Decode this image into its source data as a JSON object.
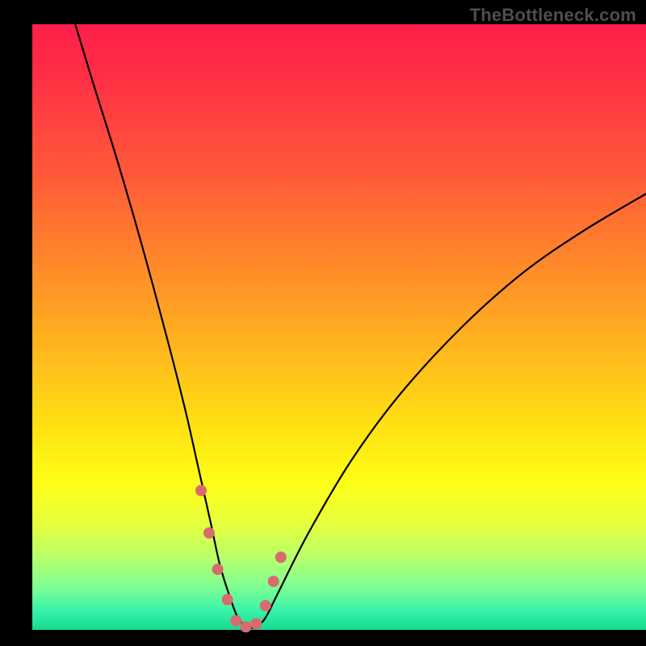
{
  "watermark": "TheBottleneck.com",
  "chart_data": {
    "type": "line",
    "title": "",
    "xlabel": "",
    "ylabel": "",
    "xlim": [
      0,
      100
    ],
    "ylim": [
      0,
      100
    ],
    "grid": false,
    "legend": false,
    "series": [
      {
        "name": "bottleneck-curve",
        "x": [
          7,
          10,
          14,
          18,
          22,
          25,
          27,
          29,
          30.5,
          32,
          33.5,
          35,
          36.5,
          38,
          40,
          45,
          52,
          60,
          70,
          80,
          90,
          100
        ],
        "values": [
          100,
          90,
          77,
          63,
          48,
          36,
          27,
          18,
          11,
          6,
          2,
          0.5,
          0.5,
          2,
          6,
          16,
          28,
          39,
          50,
          59,
          66,
          72
        ]
      }
    ],
    "markers": {
      "name": "highlighted-points",
      "color": "#d86b6e",
      "radius_px": 7,
      "x": [
        27.5,
        28.8,
        30.2,
        31.8,
        33.2,
        34.8,
        36.5,
        38.0,
        39.3,
        40.5
      ],
      "values": [
        23,
        16,
        10,
        5,
        1.5,
        0.5,
        1,
        4,
        8,
        12
      ]
    },
    "gradient_background": {
      "orientation": "vertical",
      "stops": [
        {
          "pos": 0.0,
          "color": "#ff1f49"
        },
        {
          "pos": 0.15,
          "color": "#ff4040"
        },
        {
          "pos": 0.35,
          "color": "#ff7a2e"
        },
        {
          "pos": 0.55,
          "color": "#ffbb1c"
        },
        {
          "pos": 0.76,
          "color": "#fdff17"
        },
        {
          "pos": 0.93,
          "color": "#7dff94"
        },
        {
          "pos": 1.0,
          "color": "#17d88f"
        }
      ]
    }
  }
}
